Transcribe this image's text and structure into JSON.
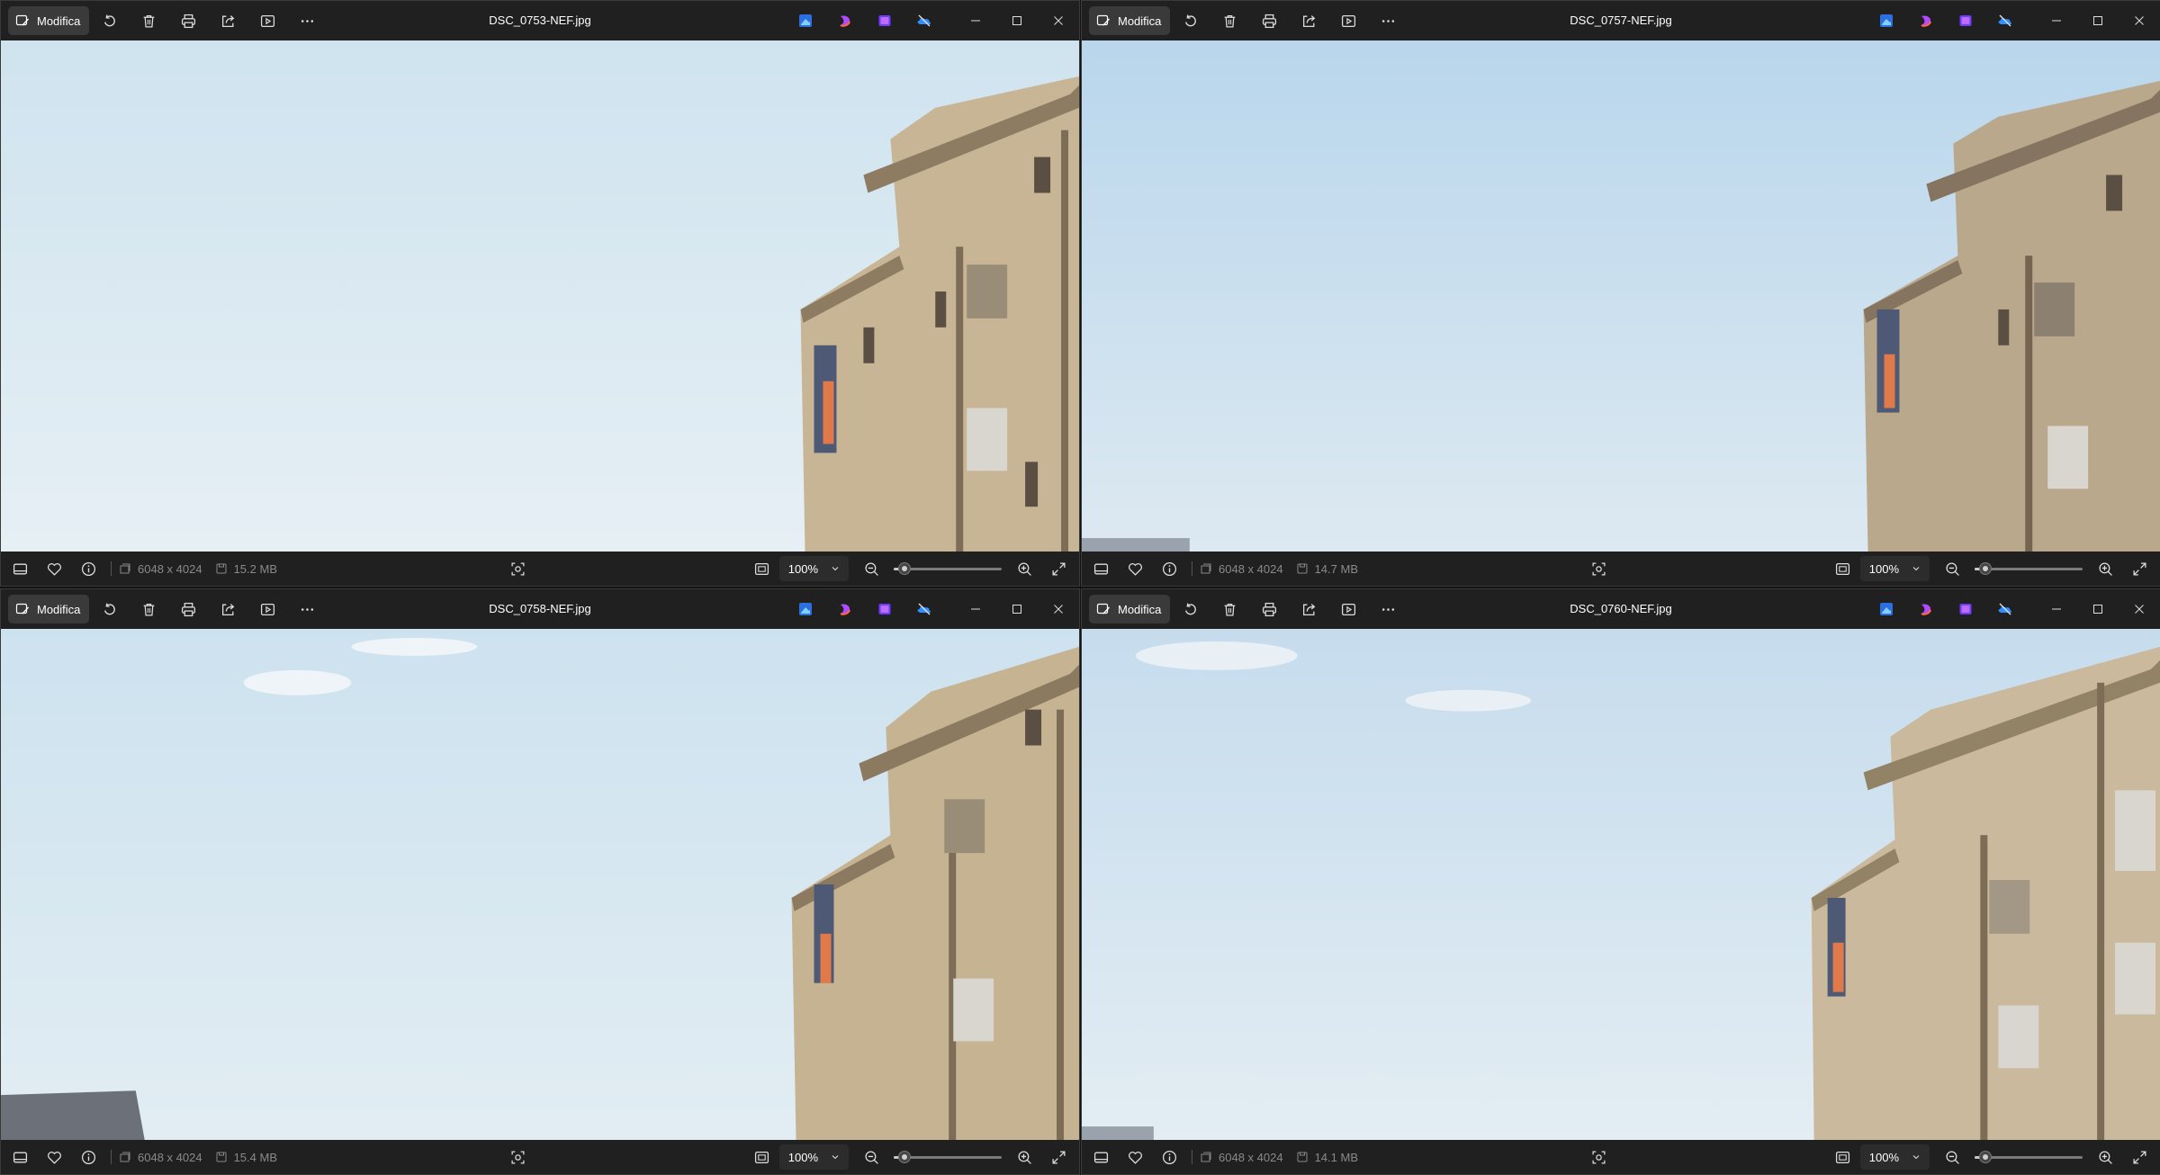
{
  "colors": {
    "sky_top": "#cfe3f1",
    "sky_bottom": "#e6f0f6",
    "building": "#c9b89a",
    "titlebar": "#202020",
    "accent": "#4cc2ff"
  },
  "common": {
    "edit_label": "Modifica",
    "dimensions": "6048 x 4024",
    "zoom_label": "100%",
    "zoom_level_fraction": 0.1,
    "toolbar_icons": [
      "rotate-icon",
      "delete-icon",
      "print-icon",
      "share-icon",
      "slideshow-icon",
      "more-icon"
    ],
    "app_icons": [
      "photo-editor-icon",
      "clipchamp-icon",
      "designer-icon",
      "onedrive-icon"
    ]
  },
  "windows": [
    {
      "title": "DSC_0753-NEF.jpg",
      "file_size": "15.2 MB"
    },
    {
      "title": "DSC_0757-NEF.jpg",
      "file_size": "14.7 MB"
    },
    {
      "title": "DSC_0758-NEF.jpg",
      "file_size": "15.4 MB"
    },
    {
      "title": "DSC_0760-NEF.jpg",
      "file_size": "14.1 MB"
    }
  ]
}
